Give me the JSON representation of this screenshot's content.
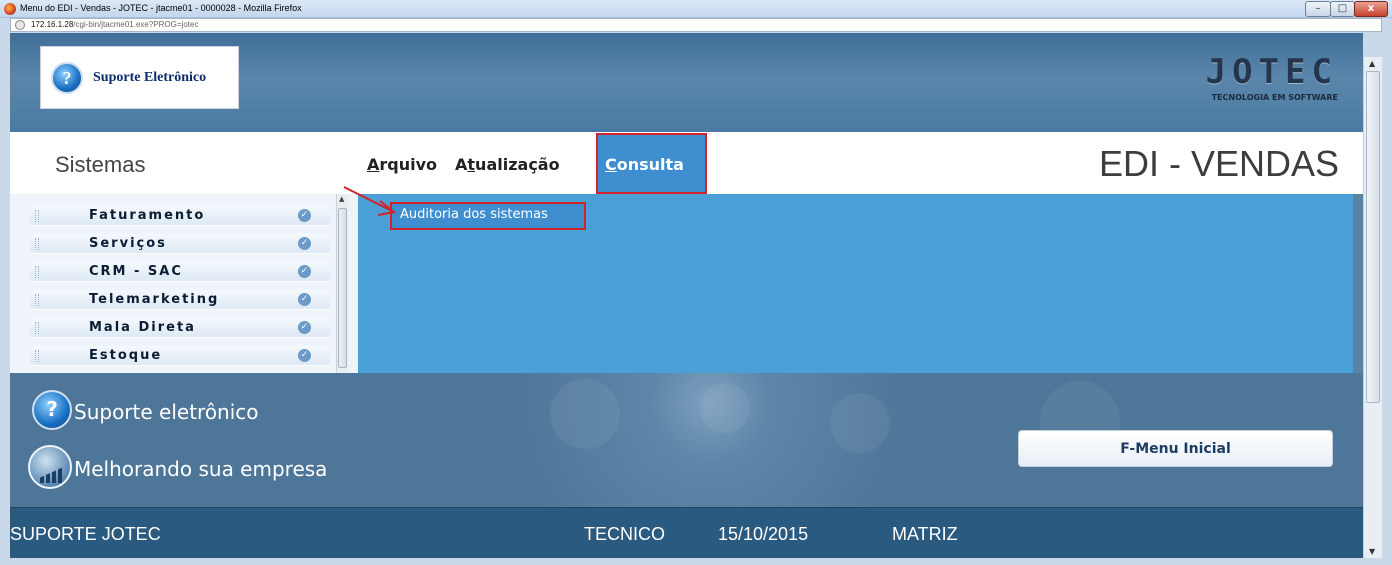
{
  "window": {
    "title": "Menu do EDI - Vendas - JOTEC - jtacme01 - 0000028 - Mozilla Firefox",
    "url_host": "172.16.1.28",
    "url_path": "/cgi-bin/jtacme01.exe?PROG=jotec",
    "buttons": {
      "minimize": "–",
      "maximize": "□",
      "close": "x"
    }
  },
  "header": {
    "support_logo_label": "Suporte Eletrônico",
    "support_icon_glyph": "?",
    "brand": "JOTEC",
    "brand_tagline": "TECNOLOGIA EM SOFTWARE"
  },
  "sidebar": {
    "title": "Sistemas",
    "items": [
      {
        "label": "Faturamento"
      },
      {
        "label": "Serviços"
      },
      {
        "label": "CRM - SAC"
      },
      {
        "label": "Telemarketing"
      },
      {
        "label": "Mala Direta"
      },
      {
        "label": "Estoque"
      }
    ]
  },
  "menubar": {
    "items": [
      {
        "label": "Arquivo",
        "accesskey": "A"
      },
      {
        "label": "Atualização",
        "accesskey": "t"
      },
      {
        "label": "Consulta",
        "accesskey": "C",
        "active": true
      }
    ],
    "module_title": "EDI - VENDAS"
  },
  "submenu": {
    "items": [
      {
        "label": "Auditoria dos sistemas"
      }
    ]
  },
  "promo": {
    "line1": "Suporte eletrônico",
    "line2": "Melhorando sua empresa",
    "button": "F-Menu Inicial"
  },
  "status": {
    "user": "SUPORTE JOTEC",
    "role": "TECNICO",
    "date": "15/10/2015",
    "branch": "MATRIZ"
  },
  "colors": {
    "highlight": "#d2232a",
    "menu_active": "#3f8fd0",
    "content_bg": "#4ba0d8",
    "status_bg": "#2b5a80"
  }
}
